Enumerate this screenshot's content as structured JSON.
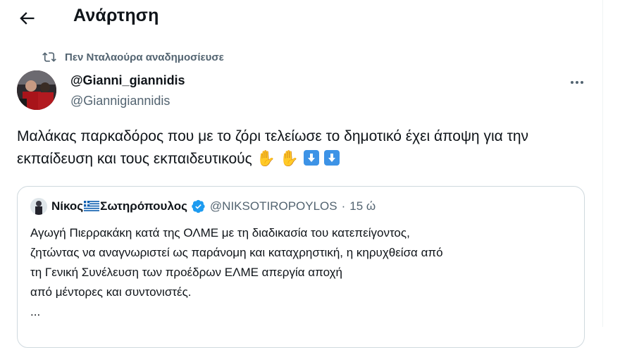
{
  "header": {
    "title": "Ανάρτηση"
  },
  "repost": {
    "label": "Πεν Νταλαούρα αναδημοσίευσε"
  },
  "post": {
    "display_name": "@Gianni_giannidis",
    "handle": "@Giannigiannidis",
    "text": "Μαλάκας παρκαδόρος που με το ζόρι τελείωσε το δημοτικό έχει άποψη για την εκπαίδευση και τους εκπαιδευτικούς",
    "emojis": [
      "✋",
      "✋",
      "⬇",
      "⬇"
    ]
  },
  "quote": {
    "name_part1": "Νίκος",
    "name_part2": "Σωτηρόπουλος",
    "handle": "@NIKSOTIROPOYLOS",
    "separator": "·",
    "time": "15 ώ",
    "text_lines": [
      "Αγωγή Πιερρακάκη κατά της ΟΛΜΕ με τη διαδικασία του κατεπείγοντος,",
      "ζητώντας να αναγνωριστεί ως παράνομη και καταχρηστική, η κηρυχθείσα από",
      "τη Γενική Συνέλευση των προέδρων ΕΛΜΕ απεργία αποχή",
      "από μέντορες και συντονιστές.",
      "..."
    ]
  },
  "icons": {
    "back": "arrow-left-icon",
    "repost": "repost-icon",
    "more": "more-horizontal-icon",
    "verified": "verified-badge-icon",
    "flag": "greek-flag-icon"
  },
  "colors": {
    "text": "#0f1419",
    "secondary": "#536471",
    "border": "#cfd9de",
    "verified": "#1d9bf0",
    "emoji_down": "#3d93e6"
  }
}
